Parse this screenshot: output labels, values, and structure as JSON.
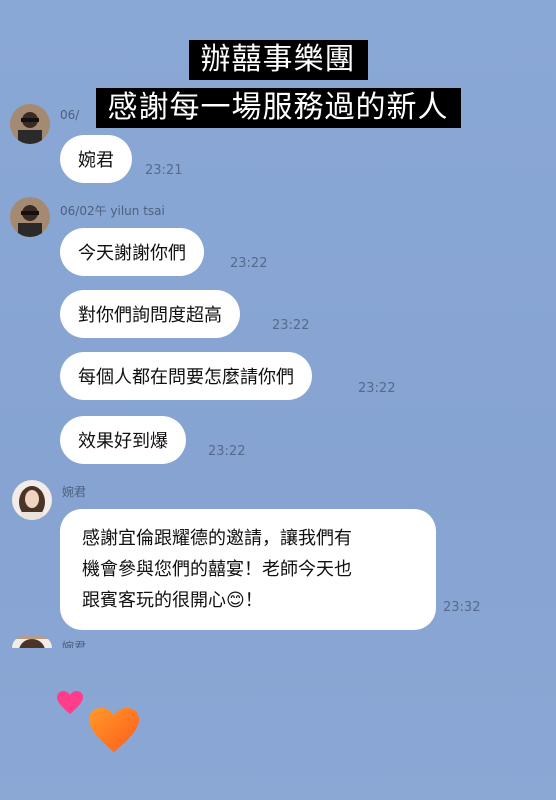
{
  "overlay": {
    "line1": "辦囍事樂團",
    "line2": "感謝每一場服務過的新人"
  },
  "chat": {
    "partial_sender": "06/",
    "messages": [
      {
        "text": "婉君",
        "time": "23:21"
      },
      {
        "sender": "06/02午 yilun tsai",
        "text": "今天謝謝你們",
        "time": "23:22"
      },
      {
        "text": "對你們詢問度超高",
        "time": "23:22"
      },
      {
        "text": "每個人都在問要怎麼請你們",
        "time": "23:22"
      },
      {
        "text": "效果好到爆",
        "time": "23:22"
      },
      {
        "sender": "婉君",
        "lines": [
          "感謝宜倫跟耀德的邀請，讓我們有",
          "機會參與您們的囍宴！老師今天也",
          "跟賓客玩的很開心😊！"
        ],
        "time": "23:32"
      }
    ],
    "cut_sender": "婉君"
  },
  "colors": {
    "background": "#87a5d3",
    "bubble": "#ffffff",
    "overlay_bg": "#000000",
    "heart_pink": "#ff3d8b",
    "heart_orange": "#ff7a1a"
  },
  "icons": [
    "pink-heart-icon",
    "orange-heart-icon",
    "smile-emoji-icon"
  ]
}
